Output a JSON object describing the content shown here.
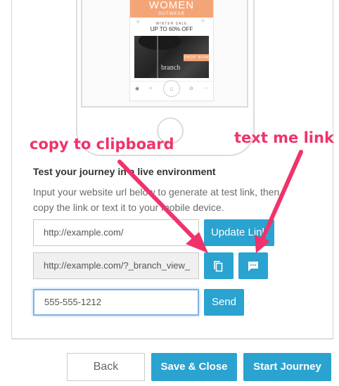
{
  "preview": {
    "brand_title": "WOMEN",
    "brand_subtitle": "OUTWEAR",
    "sale_label": "WINTER SALE",
    "sale_headline": "UP TO 60% OFF",
    "photo_brand": "branch",
    "cta": "SHOP NOW",
    "tabs": [
      "",
      "",
      "",
      "",
      ""
    ]
  },
  "annotations": {
    "copy": "copy to clipboard",
    "text": "text me link"
  },
  "section": {
    "title": "Test your journey in a live environment",
    "description": "Input your website url below to generate at test link, then copy the link or text it to your mobile device."
  },
  "form": {
    "url_value": "http://example.com/",
    "update_label": "Update Link",
    "generated_link": "http://example.com/?_branch_view_",
    "phone_value": "555-555-1212",
    "send_label": "Send"
  },
  "footer": {
    "back_label": "Back",
    "save_label": "Save & Close",
    "start_label": "Start Journey"
  },
  "colors": {
    "accent": "#2aa3d0",
    "annotation": "#f0336a",
    "promo": "#f4a578"
  }
}
